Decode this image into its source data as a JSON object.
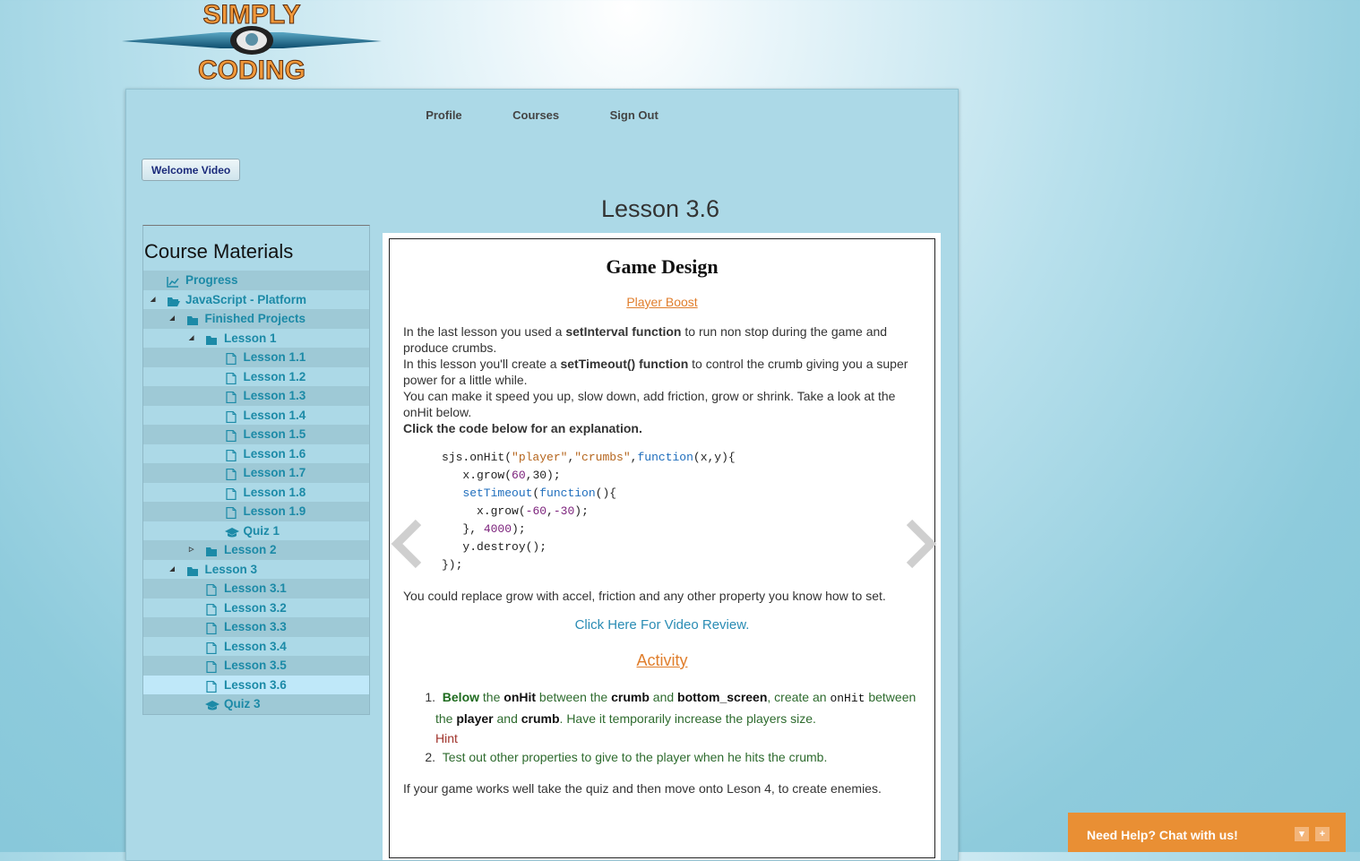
{
  "logo": {
    "line1": "SIMPLY",
    "line2": "CODING"
  },
  "nav": {
    "items": [
      "Profile",
      "Courses",
      "Sign Out"
    ]
  },
  "welcome_button": "Welcome Video",
  "lesson_title": "Lesson 3.6",
  "sidebar": {
    "title": "Course Materials",
    "items": [
      {
        "label": "Progress",
        "icon": "chart-icon"
      },
      {
        "label": "JavaScript - Platform",
        "icon": "folder-open-icon",
        "toggle": "expanded"
      },
      {
        "label": "Finished Projects",
        "icon": "folder-icon",
        "toggle": "expanded"
      },
      {
        "label": "Lesson 1",
        "icon": "folder-icon",
        "toggle": "expanded"
      },
      {
        "label": "Lesson 1.1",
        "icon": "file-icon"
      },
      {
        "label": "Lesson 1.2",
        "icon": "file-icon"
      },
      {
        "label": "Lesson 1.3",
        "icon": "file-icon"
      },
      {
        "label": "Lesson 1.4",
        "icon": "file-icon"
      },
      {
        "label": "Lesson 1.5",
        "icon": "file-icon"
      },
      {
        "label": "Lesson 1.6",
        "icon": "file-icon"
      },
      {
        "label": "Lesson 1.7",
        "icon": "file-icon"
      },
      {
        "label": "Lesson 1.8",
        "icon": "file-icon"
      },
      {
        "label": "Lesson 1.9",
        "icon": "file-icon"
      },
      {
        "label": "Quiz 1",
        "icon": "graduation-cap-icon"
      },
      {
        "label": "Lesson 2",
        "icon": "folder-icon",
        "toggle": "collapsed"
      },
      {
        "label": "Lesson 3",
        "icon": "folder-icon",
        "toggle": "expanded"
      },
      {
        "label": "Lesson 3.1",
        "icon": "file-icon"
      },
      {
        "label": "Lesson 3.2",
        "icon": "file-icon"
      },
      {
        "label": "Lesson 3.3",
        "icon": "file-icon"
      },
      {
        "label": "Lesson 3.4",
        "icon": "file-icon"
      },
      {
        "label": "Lesson 3.5",
        "icon": "file-icon"
      },
      {
        "label": "Lesson 3.6",
        "icon": "file-icon",
        "active": true
      },
      {
        "label": "Quiz 3",
        "icon": "graduation-cap-icon"
      }
    ]
  },
  "content": {
    "heading": "Game Design",
    "subtitle": "Player Boost",
    "intro": {
      "p1_a": "In the last lesson you used a ",
      "p1_b": "setInterval function",
      "p1_c": " to run non stop during the game and produce crumbs.",
      "p2_a": "In this lesson you'll create a ",
      "p2_b": "setTimeout() function",
      "p2_c": " to control the crumb giving you a super power for a little while.",
      "p3": "You can make it speed you up, slow down, add friction, grow or shrink. Take a look at the onHit below.",
      "p4": "Click the code below for an explanation."
    },
    "code": {
      "l1_a": "sjs.onHit(",
      "l1_s1": "\"player\"",
      "l1_b": ",",
      "l1_s2": "\"crumbs\"",
      "l1_c": ",",
      "l1_kw": "function",
      "l1_d": "(x,y){",
      "l2_a": "  x.grow(",
      "l2_n1": "60",
      "l2_b": ",30);",
      "l3_kw1": "setTimeout",
      "l3_a": "(",
      "l3_kw2": "function",
      "l3_b": "(){",
      "l4_a": "    x.grow(",
      "l4_n1": "-60",
      "l4_b": ",",
      "l4_n2": "-30",
      "l4_c": ");",
      "l5_a": "  }, ",
      "l5_n": "4000",
      "l5_b": ");",
      "l6": "  y.destroy();",
      "l7": "});"
    },
    "after_code": "You could replace grow with accel, friction and any other property you know how to set.",
    "video_link": "Click Here For Video Review.",
    "activity_title": "Activity",
    "steps": {
      "s1_num": "1.",
      "s1_a": "Below",
      "s1_b": " the ",
      "s1_c": "onHit",
      "s1_d": " between the ",
      "s1_e": "crumb",
      "s1_f": " and ",
      "s1_g": "bottom_screen",
      "s1_h": ", create an ",
      "s1_i": "onHit",
      "s1_j": " between",
      "s1_k": "the ",
      "s1_l": "player",
      "s1_m": " and ",
      "s1_n": "crumb",
      "s1_o": ". Have it temporarily increase the players size.",
      "hint": "Hint",
      "s2_num": "2.",
      "s2": "Test out other properties to give to the player when he hits the crumb."
    },
    "closing": "If your game works well take the quiz and then move onto Leson 4, to create enemies."
  },
  "chat": {
    "label": "Need Help? Chat with us!",
    "minimize": "▾",
    "expand": "+"
  }
}
